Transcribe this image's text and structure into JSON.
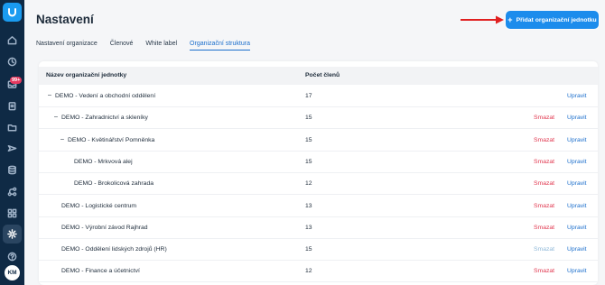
{
  "sidebar": {
    "logo": "app-logo",
    "items": [
      {
        "icon": "home-icon"
      },
      {
        "icon": "clock-icon"
      },
      {
        "icon": "inbox-icon",
        "badge": "99+"
      },
      {
        "icon": "clipboard-icon"
      },
      {
        "icon": "folder-icon"
      },
      {
        "icon": "send-icon"
      },
      {
        "icon": "database-icon"
      },
      {
        "icon": "hierarchy-icon"
      },
      {
        "icon": "grid-icon"
      },
      {
        "icon": "gear-icon",
        "active": true
      },
      {
        "icon": "help-icon"
      }
    ],
    "avatar": "KM"
  },
  "header": {
    "title": "Nastavení",
    "add_button": "Přidat organizační jednotku",
    "accent": "#1c8cec"
  },
  "tabs": [
    {
      "label": "Nastavení organizace",
      "active": false
    },
    {
      "label": "Členové",
      "active": false
    },
    {
      "label": "White label",
      "active": false
    },
    {
      "label": "Organizační struktura",
      "active": true
    }
  ],
  "table": {
    "columns": [
      "Název organizační jednotky",
      "Počet členů"
    ],
    "delete_label": "Smazat",
    "edit_label": "Upravit",
    "rows": [
      {
        "name": "DEMO - Vedení a obchodní oddělení",
        "count": "17",
        "level": 0,
        "collapse": "–",
        "delete": false
      },
      {
        "name": "DEMO - Zahradnictví a skleníky",
        "count": "15",
        "level": 1,
        "collapse": "–",
        "delete": true
      },
      {
        "name": "DEMO - Květinářství Pomněnka",
        "count": "15",
        "level": 2,
        "collapse": "–",
        "delete": true
      },
      {
        "name": "DEMO - Mrkvová alej",
        "count": "15",
        "level": 3,
        "collapse": "",
        "delete": true
      },
      {
        "name": "DEMO - Brokolicová zahrada",
        "count": "12",
        "level": 3,
        "collapse": "",
        "delete": true
      },
      {
        "name": "DEMO - Logistické centrum",
        "count": "13",
        "level": 1,
        "collapse": "",
        "delete": true
      },
      {
        "name": "DEMO - Výrobní závod Rajhrad",
        "count": "13",
        "level": 1,
        "collapse": "",
        "delete": true
      },
      {
        "name": "DEMO - Oddělení lidských zdrojů (HR)",
        "count": "15",
        "level": 1,
        "collapse": "",
        "delete": true,
        "delete_muted": true
      },
      {
        "name": "DEMO - Finance a účetnictví",
        "count": "12",
        "level": 1,
        "collapse": "",
        "delete": true
      }
    ]
  },
  "colors": {
    "sidebar_bg": "#0f2a45",
    "delete": "#e0354d",
    "edit": "#1c6fcc",
    "arrow": "#e02020"
  }
}
